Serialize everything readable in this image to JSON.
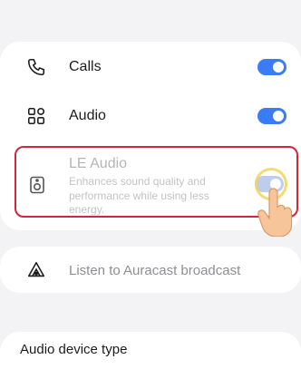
{
  "settings": {
    "calls": {
      "label": "Calls",
      "icon": "phone-icon",
      "enabled": true
    },
    "audio": {
      "label": "Audio",
      "icon": "audio-apps-icon",
      "enabled": true
    },
    "le_audio": {
      "title": "LE Audio",
      "description": "Enhances sound quality and performance while using less energy.",
      "icon": "speaker-device-icon",
      "enabled": true,
      "highlighted": true
    },
    "auracast": {
      "label": "Listen to Auracast broadcast",
      "icon": "auracast-icon"
    },
    "device_type": {
      "label": "Audio device type"
    }
  },
  "colors": {
    "accent": "#3a7cf5",
    "highlight_border": "#d3263a",
    "tap_ripple": "#f1d35a"
  }
}
